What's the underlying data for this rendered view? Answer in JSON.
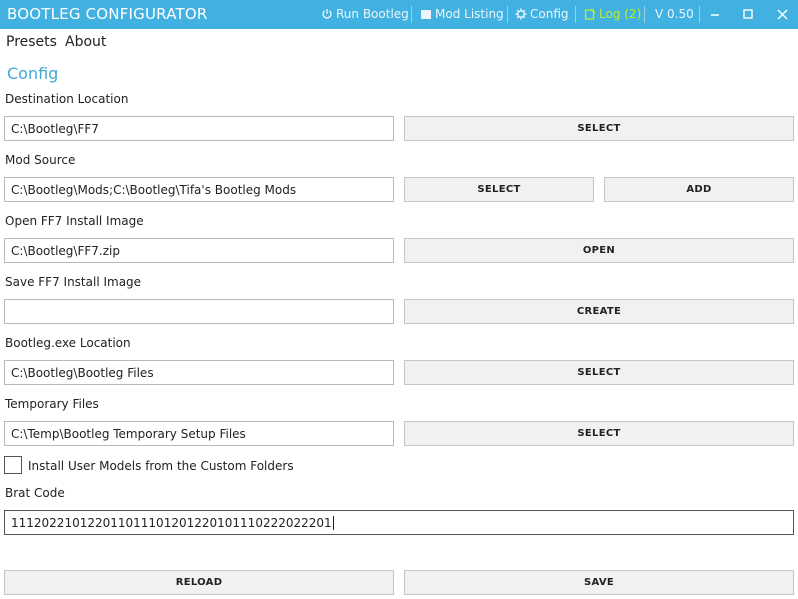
{
  "window": {
    "title": "BOOTLEG CONFIGURATOR",
    "commands": {
      "run": "Run Bootleg",
      "mods": "Mod Listing",
      "config": "Config",
      "log": "Log (2)",
      "version": "V 0.50"
    },
    "controls": {
      "minimize": "—",
      "maximize": "☐",
      "close": "✕"
    }
  },
  "menu": {
    "presets": "Presets",
    "about": "About"
  },
  "section_title": "Config",
  "fields": {
    "destination": {
      "label": "Destination Location",
      "value": "C:\\Bootleg\\FF7",
      "button": "SELECT"
    },
    "mod_source": {
      "label": "Mod Source",
      "value": "C:\\Bootleg\\Mods;C:\\Bootleg\\Tifa's Bootleg Mods",
      "button_select": "SELECT",
      "button_add": "ADD"
    },
    "open_image": {
      "label": "Open FF7 Install Image",
      "value": "C:\\Bootleg\\FF7.zip",
      "button": "OPEN"
    },
    "save_image": {
      "label": "Save FF7 Install Image",
      "value": "",
      "button": "CREATE"
    },
    "exe_location": {
      "label": "Bootleg.exe Location",
      "value": "C:\\Bootleg\\Bootleg Files",
      "button": "SELECT"
    },
    "temp_files": {
      "label": "Temporary Files",
      "value": "C:\\Temp\\Bootleg Temporary Setup Files",
      "button": "SELECT"
    }
  },
  "checkbox": {
    "label": "Install User Models from the Custom Folders",
    "checked": false
  },
  "brat_code": {
    "label": "Brat Code",
    "value": "111202210122011011101201220101110222022201"
  },
  "footer": {
    "reload": "RELOAD",
    "save": "SAVE"
  },
  "colors": {
    "accent": "#41b1e1",
    "log": "#b7f032",
    "section_title": "#41a9d6"
  }
}
